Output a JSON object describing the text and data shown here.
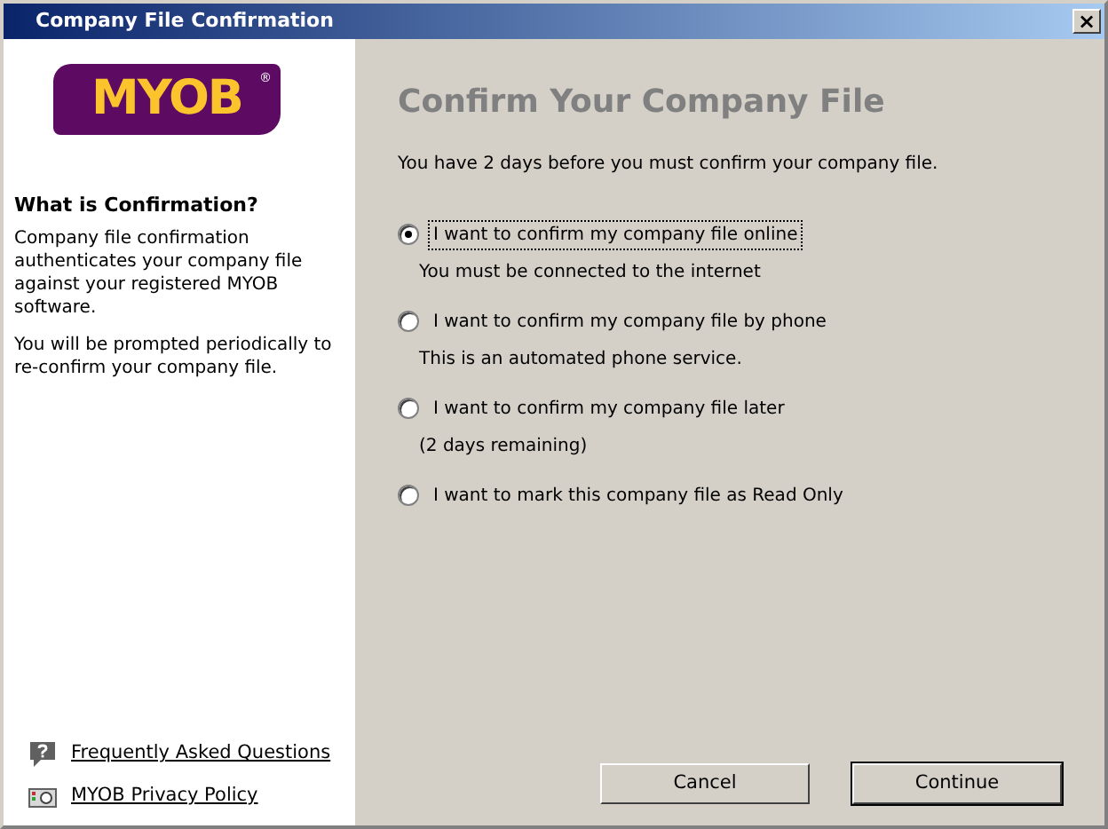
{
  "window": {
    "title": "Company File Confirmation",
    "close": "×"
  },
  "sidebar": {
    "logo": {
      "text": "MYOB",
      "mark": "®"
    },
    "heading": "What is Confirmation?",
    "paragraphs": [
      "Company file confirmation authenticates your company file against your registered MYOB software.",
      "You will be prompted periodically to re-confirm your company file."
    ],
    "links": [
      {
        "kind": "faq",
        "label": "Frequently Asked Questions"
      },
      {
        "kind": "privacy",
        "label": "MYOB Privacy Policy"
      }
    ]
  },
  "main": {
    "title": "Confirm Your Company File",
    "intro": "You have 2 days before you must confirm your company file.",
    "options": [
      {
        "label": "I want to confirm my company file online",
        "note": "You must be connected to the internet",
        "selected": true
      },
      {
        "label": "I want to confirm my company file by phone",
        "note": "This is an automated phone service.",
        "selected": false
      },
      {
        "label": "I want to confirm my company file later",
        "note": "(2 days remaining)",
        "selected": false
      },
      {
        "label": "I want to mark this company file as Read Only",
        "selected": false
      }
    ],
    "buttons": [
      {
        "label": "Cancel",
        "default": false
      },
      {
        "label": "Continue",
        "default": true
      }
    ]
  }
}
